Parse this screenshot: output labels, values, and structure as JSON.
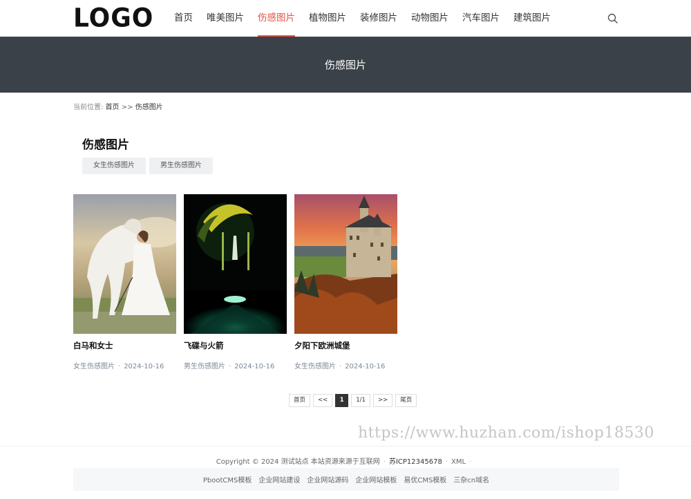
{
  "header": {
    "logo": "LOGO",
    "nav": [
      "首页",
      "唯美图片",
      "伤感图片",
      "植物图片",
      "装修图片",
      "动物图片",
      "汽车图片",
      "建筑图片"
    ],
    "active_index": 2,
    "accent_color": "#e8513d",
    "search_icon": "search-icon"
  },
  "banner": {
    "title": "伤感图片",
    "bg_color": "#3b4148"
  },
  "breadcrumb": {
    "label": "当前位置:",
    "home": "首页",
    "sep": ">>",
    "current": "伤感图片"
  },
  "category": {
    "title": "伤感图片",
    "subcategories": [
      "女生伤感图片",
      "男生伤感图片"
    ]
  },
  "cards": [
    {
      "title": "白马和女士",
      "category": "女生伤感图片",
      "date": "2024-10-16"
    },
    {
      "title": "飞碟与火箭",
      "category": "男生伤感图片",
      "date": "2024-10-16"
    },
    {
      "title": "夕阳下欧洲城堡",
      "category": "女生伤感图片",
      "date": "2024-10-16"
    }
  ],
  "pagination": {
    "first": "首页",
    "prev": "<<",
    "current": "1",
    "info": "1/1",
    "next": ">>",
    "last": "尾页"
  },
  "footer": {
    "copyright": "Copyright © 2024 测试站点 本站资源来源于互联网",
    "dot": "·",
    "icp": "苏ICP12345678",
    "xml": "XML",
    "links": [
      "PbootCMS模板",
      "企业网站建设",
      "企业网站源码",
      "企业网站模板",
      "易优CMS模板",
      "三杂cn域名"
    ]
  },
  "watermark": "https://www.huzhan.com/ishop18530"
}
